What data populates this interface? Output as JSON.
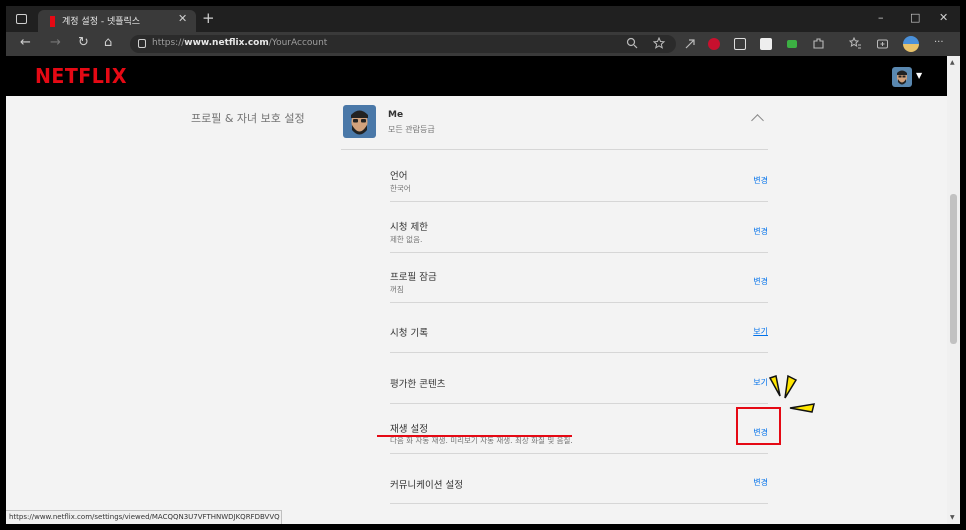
{
  "browser": {
    "tab_title": "계정 설정 - 넷플릭스",
    "tab_close": "✕",
    "new_tab": "+",
    "url_prefix": "https://",
    "url_domain": "www.netflix.com",
    "url_path": "/YourAccount",
    "status_url": "https://www.netflix.com/settings/viewed/MACQQN3U7VFTHNWDJKQRFDBVVQ",
    "controls": {
      "minimize": "–",
      "maximize": "□",
      "close": "✕"
    },
    "nav": {
      "back": "←",
      "forward": "→",
      "refresh": "↻",
      "home": "⌂"
    },
    "more": "···"
  },
  "netflix": {
    "logo": "NETFLIX",
    "caret": "▼"
  },
  "profile_section": {
    "label": "프로필 & 자녀 보호 설정",
    "name": "Me",
    "rating": "모든 관람등급"
  },
  "settings": [
    {
      "title": "언어",
      "subtitle": "한국어",
      "action": "변경",
      "action_style": "plain"
    },
    {
      "title": "시청 제한",
      "subtitle": "제한 없음.",
      "action": "변경",
      "action_style": "plain"
    },
    {
      "title": "프로필 잠금",
      "subtitle": "꺼짐",
      "action": "변경",
      "action_style": "plain"
    },
    {
      "title": "시청 기록",
      "subtitle": "",
      "action": "보기",
      "action_style": "link"
    },
    {
      "title": "평가한 콘텐츠",
      "subtitle": "",
      "action": "보기",
      "action_style": "plain"
    },
    {
      "title": "재생 설정",
      "subtitle": "다음 화 자동 재생. 미리보기 자동 재생. 최상 화질 및 음질.",
      "action": "변경",
      "action_style": "plain"
    },
    {
      "title": "커뮤니케이션 설정",
      "subtitle": "",
      "action": "변경",
      "action_style": "plain"
    }
  ],
  "colors": {
    "netflix_red": "#e50914",
    "link_blue": "#0071eb",
    "annotation_red": "#e50914",
    "annotation_yellow": "#ffe600"
  }
}
